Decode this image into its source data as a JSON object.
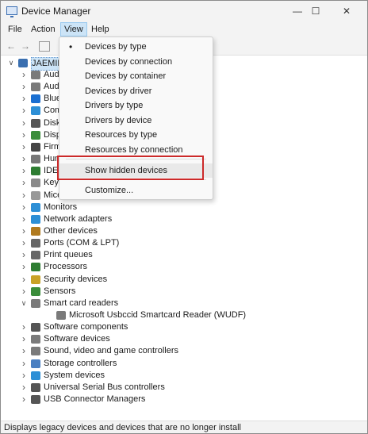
{
  "window": {
    "title": "Device Manager",
    "controls": {
      "minimize": "—",
      "maximize": "☐",
      "close": "✕"
    }
  },
  "menubar": [
    "File",
    "Action",
    "View",
    "Help"
  ],
  "toolbar": {
    "back": "←",
    "forward": "→"
  },
  "tree": {
    "root": "JAEMIN",
    "categories": [
      {
        "label": "Audio inputs and outputs",
        "visible": "Aud",
        "color": "#7a7a7a"
      },
      {
        "label": "Audio Processing Objects",
        "visible": "Aud",
        "color": "#7a7a7a"
      },
      {
        "label": "Bluetooth",
        "visible": "Blue",
        "color": "#1a6fd1"
      },
      {
        "label": "Computer",
        "visible": "Com",
        "color": "#2d8fd6"
      },
      {
        "label": "Disk drives",
        "visible": "Disk",
        "color": "#555555"
      },
      {
        "label": "Display adapters",
        "visible": "Disp",
        "color": "#3b8d3b"
      },
      {
        "label": "Firmware",
        "visible": "Firm",
        "color": "#444444"
      },
      {
        "label": "Human Interface Devices",
        "visible": "Hum",
        "color": "#777777"
      },
      {
        "label": "IDE ATA/ATAPI controllers",
        "visible": "IDE A",
        "color": "#2e7d32"
      },
      {
        "label": "Keyboards",
        "visible": "Keyb",
        "color": "#8a8a8a"
      },
      {
        "label": "Mice and other pointing devices",
        "visible": "Mice",
        "color": "#999999"
      },
      {
        "label": "Monitors",
        "color": "#2d8fd6"
      },
      {
        "label": "Network adapters",
        "color": "#2d8fd6"
      },
      {
        "label": "Other devices",
        "color": "#b07a1f"
      },
      {
        "label": "Ports (COM & LPT)",
        "color": "#666666"
      },
      {
        "label": "Print queues",
        "color": "#666666"
      },
      {
        "label": "Processors",
        "color": "#2e7d32"
      },
      {
        "label": "Security devices",
        "color": "#c9a227"
      },
      {
        "label": "Sensors",
        "color": "#3b8d3b"
      },
      {
        "label": "Smart card readers",
        "color": "#7a7a7a",
        "expanded": true
      },
      {
        "label": "Microsoft Usbccid Smartcard Reader (WUDF)",
        "color": "#7a7a7a",
        "child": true
      },
      {
        "label": "Software components",
        "color": "#555555"
      },
      {
        "label": "Software devices",
        "color": "#7a7a7a"
      },
      {
        "label": "Sound, video and game controllers",
        "color": "#7a7a7a"
      },
      {
        "label": "Storage controllers",
        "color": "#4a7fc1"
      },
      {
        "label": "System devices",
        "color": "#2d8fd6"
      },
      {
        "label": "Universal Serial Bus controllers",
        "color": "#555555"
      },
      {
        "label": "USB Connector Managers",
        "color": "#555555"
      }
    ]
  },
  "view_menu": {
    "items": [
      {
        "label": "Devices by type",
        "checked": true
      },
      {
        "label": "Devices by connection"
      },
      {
        "label": "Devices by container"
      },
      {
        "label": "Devices by driver"
      },
      {
        "label": "Drivers by type"
      },
      {
        "label": "Drivers by device"
      },
      {
        "label": "Resources by type"
      },
      {
        "label": "Resources by connection"
      },
      {
        "label": "Show hidden devices",
        "highlighted": true
      },
      {
        "label": "Customize..."
      }
    ]
  },
  "status": "Displays legacy devices and devices that are no longer install",
  "accent": "#cce4f7",
  "highlight_box_color": "#cc2a2a"
}
